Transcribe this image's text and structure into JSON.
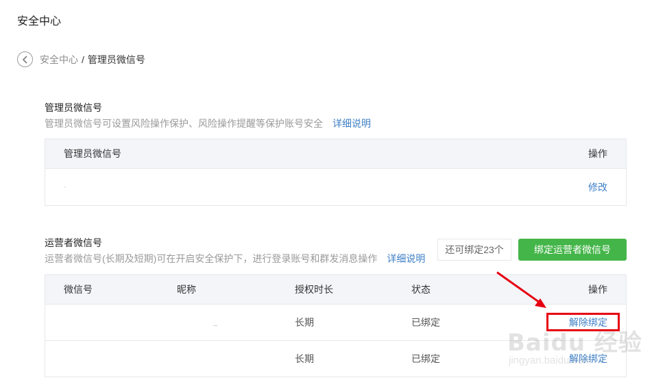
{
  "header": {
    "title": "安全中心"
  },
  "breadcrumb": {
    "parent": "安全中心",
    "separator": "/",
    "current": "管理员微信号"
  },
  "admin": {
    "title": "管理员微信号",
    "desc": "管理员微信号可设置风险操作保护、风险操作提醒等保护账号安全",
    "link": "详细说明",
    "table": {
      "col_name": "管理员微信号",
      "col_action": "操作",
      "rows": [
        {
          "name": "·",
          "action": "修改"
        }
      ]
    }
  },
  "operator": {
    "title": "运营者微信号",
    "desc": "运营者微信号(长期及短期)可在开启安全保护下，进行登录账号和群发消息操作",
    "link": "详细说明",
    "remaining": "还可绑定23个",
    "bind_button": "绑定运营者微信号",
    "table": {
      "cols": [
        "微信号",
        "昵称",
        "授权时长",
        "状态",
        "操作"
      ],
      "rows": [
        {
          "wechat": "",
          "nickname": "_",
          "duration": "长期",
          "status": "已绑定",
          "action": "解除绑定"
        },
        {
          "wechat": "",
          "nickname": "",
          "duration": "长期",
          "status": "已绑定",
          "action": "解除绑定"
        }
      ]
    }
  },
  "watermark": {
    "main": "Baidu 经验",
    "sub": "jingyan.baidu.com"
  },
  "colors": {
    "accent_link": "#3d7fc6",
    "button_green": "#44b549",
    "highlight_red": "#e60012"
  },
  "icons": {
    "back": "chevron-left-circle-icon"
  }
}
